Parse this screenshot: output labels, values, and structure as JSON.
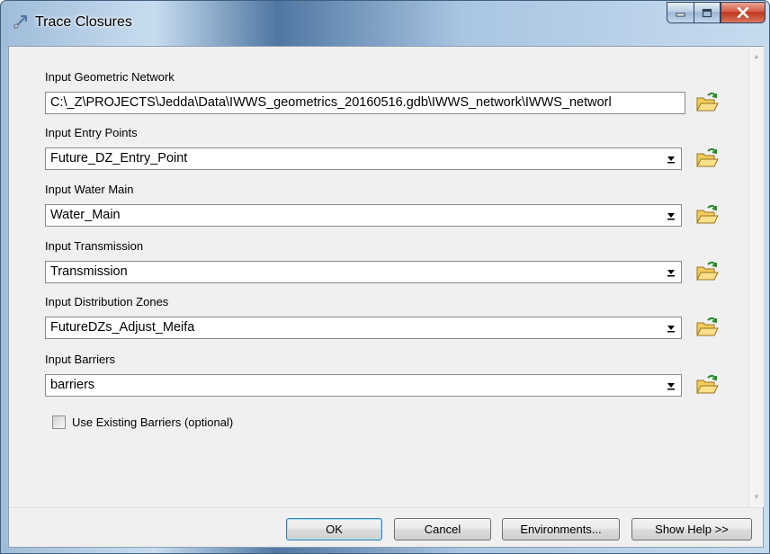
{
  "window": {
    "title": "Trace Closures",
    "icon": "tool-icon",
    "controls": [
      "minimize-icon",
      "maximize-icon",
      "close-icon"
    ]
  },
  "fields": {
    "geometric_network": {
      "label": "Input Geometric Network",
      "value": "C:\\_Z\\PROJECTS\\Jedda\\Data\\IWWS_geometrics_20160516.gdb\\IWWS_network\\IWWS_networl"
    },
    "entry_points": {
      "label": "Input Entry Points",
      "value": "Future_DZ_Entry_Point"
    },
    "water_main": {
      "label": "Input Water Main",
      "value": "Water_Main"
    },
    "transmission": {
      "label": "Input Transmission",
      "value": "Transmission"
    },
    "distribution_zones": {
      "label": "Input Distribution Zones",
      "value": "FutureDZs_Adjust_Meifa"
    },
    "barriers": {
      "label": "Input Barriers",
      "value": "barriers"
    }
  },
  "use_existing_barriers": {
    "label": "Use Existing Barriers (optional)",
    "checked": false
  },
  "buttons": {
    "ok": "OK",
    "cancel": "Cancel",
    "environments": "Environments...",
    "show_help": "Show Help >>"
  },
  "icons": {
    "browse": "open-folder-icon",
    "dropdown": "chevron-down-icon"
  }
}
